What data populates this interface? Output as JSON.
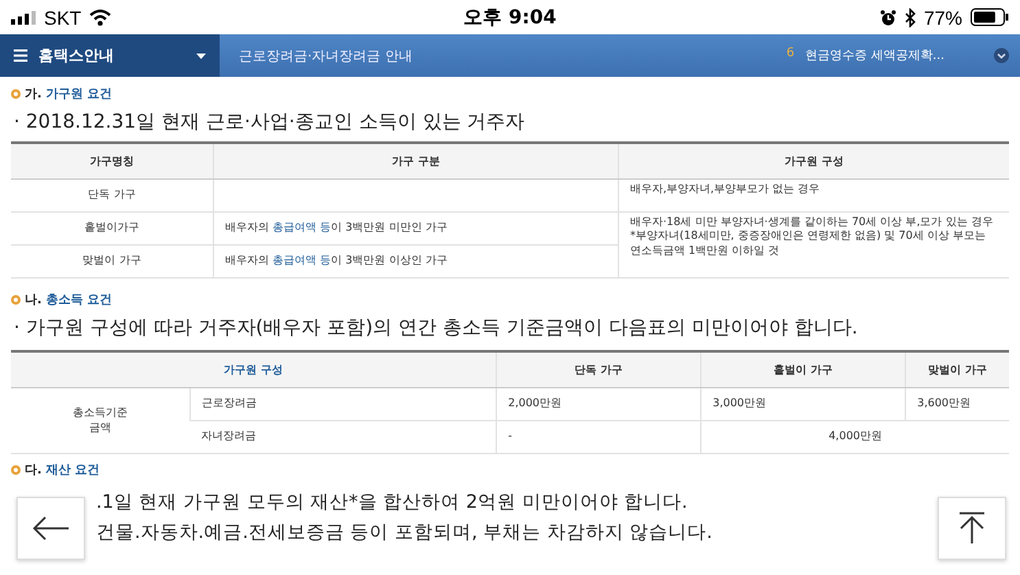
{
  "status_bar": {
    "carrier": "SKT",
    "time": "오후 9:04",
    "battery": "77%"
  },
  "nav": {
    "home": "홈택스안내",
    "breadcrumb": "근로장려금·자녀장려금 안내",
    "notice_number": "6",
    "notice": "현금영수증 세액공제확..."
  },
  "sections": [
    {
      "label": "가.",
      "title": "가구원 요건",
      "lead": "· 2018.12.31일 현재 근로·사업·종교인 소득이 있는 거주자"
    },
    {
      "label": "나.",
      "title": "총소득 요건",
      "lead": "· 가구원 구성에 따라 거주자(배우자 포함)의 연간 총소득 기준금액이 다음표의 미만이어야 합니다."
    },
    {
      "label": "다.",
      "title": "재산 요건",
      "lines": [
        ".1일 현재 가구원 모두의 재산*을 합산하여 2억원 미만이어야 합니다.",
        "건물.자동차.예금.전세보증금 등이 포함되며, 부채는 차감하지 않습니다."
      ]
    }
  ],
  "household_table": {
    "columns": [
      "가구명칭",
      "가구 구분",
      "가구원 구성"
    ],
    "rows": [
      {
        "name": "단독 가구",
        "type": "",
        "members": "배우자,부양자녀,부양부모가 없는 경우"
      },
      {
        "name": "홑벌이가구",
        "type": "배우자의 **총급여액 등**이 3백만원 미만인 가구",
        "members": "배우자·18세 미만 부양자녀·생계를 같이하는 70세 이상 부,모가 있는 경우 *부양자녀(18세미만, 중증장애인은 연령제한 없음) 및 70세 이상 부모는 연소득금액 1백만원 이하일 것"
      },
      {
        "name": "맞벌이 가구",
        "type": "배우자의 **총급여액 등**이 3백만원 이상인 가구"
      }
    ]
  },
  "income_table": {
    "columns": [
      "가구원 구성",
      "단독 가구",
      "홑벌이 가구",
      "맞벌이 가구"
    ],
    "group": "총소득기준 금액",
    "rows": [
      {
        "name": "근로장려금",
        "values": [
          "2,000만원",
          "3,000만원",
          "3,600만원"
        ]
      },
      {
        "name": "자녀장려금",
        "values": [
          "-",
          "4,000만원"
        ]
      }
    ]
  }
}
